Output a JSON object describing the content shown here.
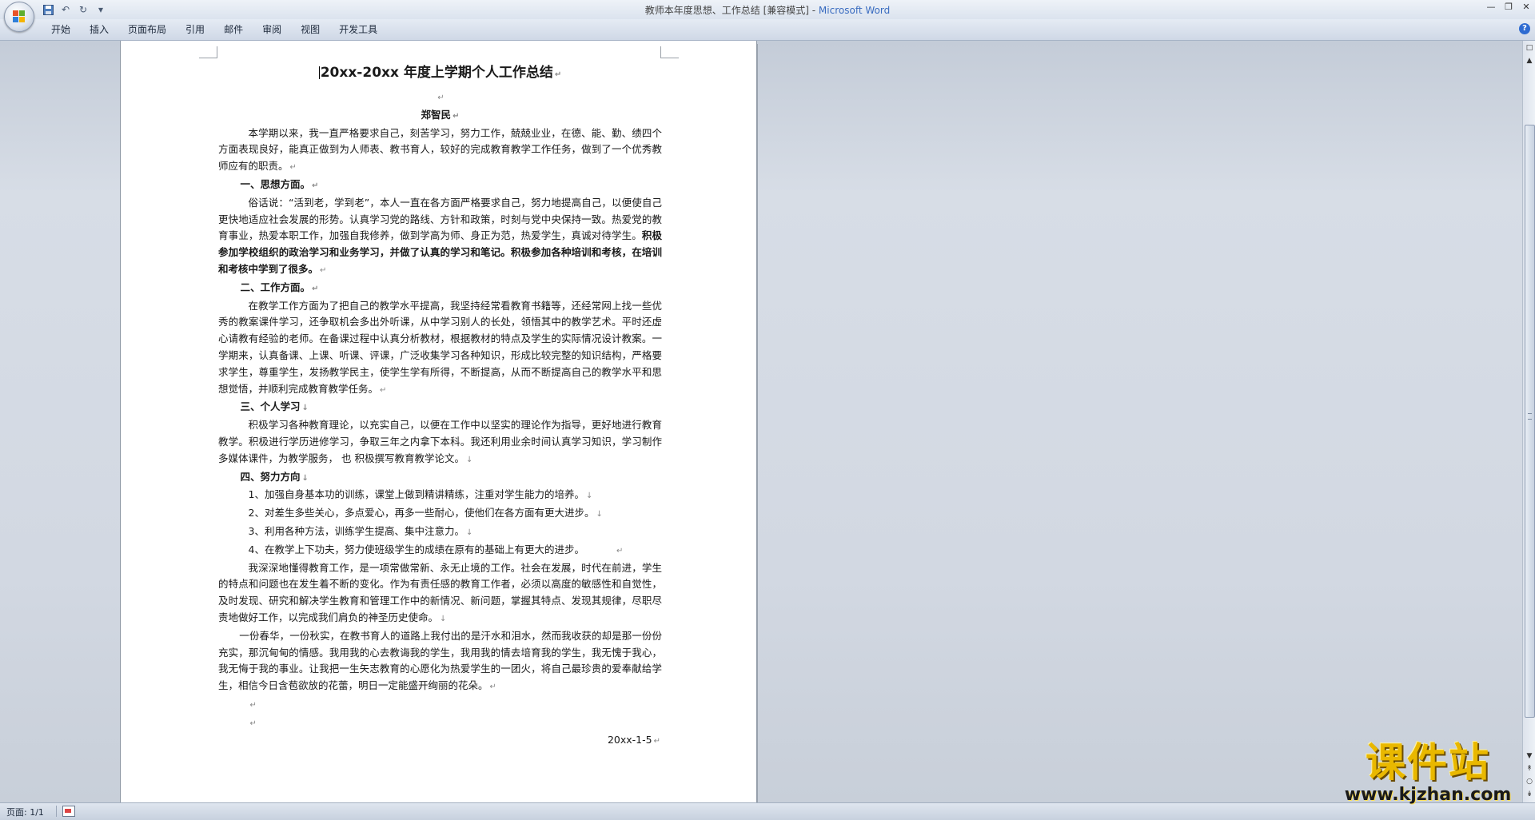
{
  "window": {
    "title": "教师本年度思想、工作总结 [兼容模式] - ",
    "app_name": "Microsoft Word"
  },
  "quick_access": {
    "save_icon": "save-icon",
    "undo_glyph": "↶",
    "redo_glyph": "↻",
    "customize_glyph": "▾"
  },
  "ribbon": {
    "tabs": [
      "开始",
      "插入",
      "页面布局",
      "引用",
      "邮件",
      "审阅",
      "视图",
      "开发工具"
    ],
    "help_glyph": "?"
  },
  "document": {
    "title": "20xx-20xx 年度上学期个人工作总结",
    "author": "郑智民",
    "intro": "本学期以来，我一直严格要求自己，刻苦学习，努力工作，兢兢业业，在德、能、勤、绩四个方面表现良好，能真正做到为人师表、教书育人，较好的完成教育教学工作任务，做到了一个优秀教师应有的职责。",
    "section1_heading": "一、思想方面。",
    "section1_text": "俗话说：“活到老，学到老”，本人一直在各方面严格要求自己，努力地提高自己，以便使自己更快地适应社会发展的形势。认真学习党的路线、方针和政策，时刻与党中央保持一致。热爱党的教育事业，热爱本职工作，加强自我修养，做到学高为师、身正为范，热爱学生，真诚对待学生。",
    "section1_bold": "积极参加学校组织的政治学习和业务学习，并做了认真的学习和笔记。积极参加各种培训和考核，在培训和考核中学到了很多。",
    "section2_heading": "二、工作方面。",
    "section2_text": "在教学工作方面为了把自己的教学水平提高，我坚持经常看教育书籍等，还经常网上找一些优秀的教案课件学习，还争取机会多出外听课，从中学习别人的长处，领悟其中的教学艺术。平时还虚心请教有经验的老师。在备课过程中认真分析教材，根据教材的特点及学生的实际情况设计教案。一学期来，认真备课、上课、听课、评课，广泛收集学习各种知识，形成比较完整的知识结构，严格要求学生，尊重学生，发扬教学民主，使学生学有所得，不断提高，从而不断提高自己的教学水平和思想觉悟，并顺利完成教育教学任务。",
    "section3_heading": "三、个人学习",
    "section3_text": "积极学习各种教育理论，以充实自己，以便在工作中以坚实的理论作为指导，更好地进行教育教学。积极进行学历进修学习，争取三年之内拿下本科。我还利用业余时间认真学习知识，学习制作多媒体课件，为教学服务，  也  积极撰写教育教学论文。",
    "section4_heading": "四、努力方向",
    "items": [
      "1、加强自身基本功的训练，课堂上做到精讲精练，注重对学生能力的培养。",
      "2、对差生多些关心，多点爱心，再多一些耐心，使他们在各方面有更大进步。",
      "3、利用各种方法，训练学生提高、集中注意力。",
      "4、在教学上下功夫，努力使班级学生的成绩在原有的基础上有更大的进步。"
    ],
    "closing1": "我深深地懂得教育工作，是一项常做常新、永无止境的工作。社会在发展，时代在前进，学生的特点和问题也在发生着不断的变化。作为有责任感的教育工作者，必须以高度的敏感性和自觉性，及时发现、研究和解决学生教育和管理工作中的新情况、新问题，掌握其特点、发现其规律，尽职尽责地做好工作，以完成我们肩负的神圣历史使命。",
    "closing2": "一份春华，一份秋实，在教书育人的道路上我付出的是汗水和泪水，然而我收获的却是那一份份充实，那沉甸甸的情感。我用我的心去教诲我的学生，我用我的情去培育我的学生，我无愧于我心，我无悔于我的事业。让我把一生矢志教育的心愿化为热爱学生的一团火，将自己最珍贵的爱奉献给学生，相信今日含苞欲放的花蕾，明日一定能盛开绚丽的花朵。",
    "date": "20xx-1-5",
    "para_mark": "↵",
    "line_mark": "↓"
  },
  "watermark": {
    "text": "课件站",
    "url": "www.kjzhan.com"
  },
  "statusbar": {
    "page_label": "页面: 1/1"
  },
  "colors": {
    "accent": "#3a6cc0",
    "watermark_gold": "#e9b800"
  }
}
